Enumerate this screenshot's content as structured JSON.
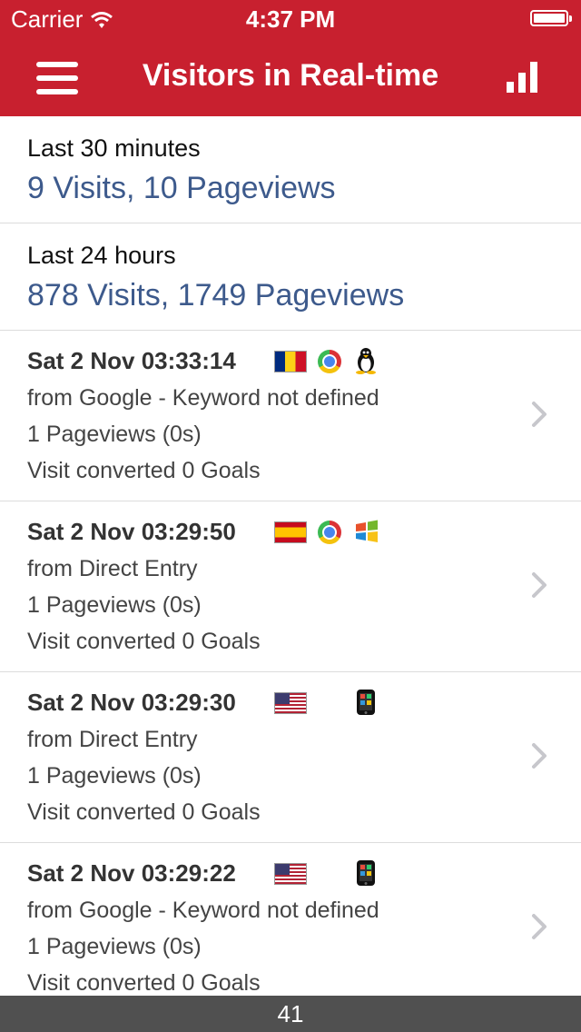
{
  "status_bar": {
    "carrier": "Carrier",
    "time": "4:37 PM"
  },
  "nav": {
    "title": "Visitors in Real-time"
  },
  "summary": [
    {
      "label": "Last 30 minutes",
      "value": "9 Visits, 10 Pageviews"
    },
    {
      "label": "Last 24 hours",
      "value": "878 Visits, 1749 Pageviews"
    }
  ],
  "visits": [
    {
      "time": "Sat 2 Nov 03:33:14",
      "source": "from Google - Keyword not defined",
      "pageviews": "1 Pageviews (0s)",
      "goals": "Visit converted 0 Goals",
      "flag_icon": "romania-flag-icon",
      "browser_icon": "chrome-icon",
      "os_icon": "linux-icon"
    },
    {
      "time": "Sat 2 Nov 03:29:50",
      "source": "from Direct Entry",
      "pageviews": "1 Pageviews (0s)",
      "goals": "Visit converted 0 Goals",
      "flag_icon": "spain-flag-icon",
      "browser_icon": "chrome-icon",
      "os_icon": "windows-icon"
    },
    {
      "time": "Sat 2 Nov 03:29:30",
      "source": "from Direct Entry",
      "pageviews": "1 Pageviews (0s)",
      "goals": "Visit converted 0 Goals",
      "flag_icon": "usa-flag-icon",
      "browser_icon": "",
      "os_icon": "ios-device-icon"
    },
    {
      "time": "Sat 2 Nov 03:29:22",
      "source": "from Google - Keyword not defined",
      "pageviews": "1 Pageviews (0s)",
      "goals": "Visit converted 0 Goals",
      "flag_icon": "usa-flag-icon",
      "browser_icon": "",
      "os_icon": "ios-device-icon"
    }
  ],
  "footer": {
    "count": "41"
  },
  "colors": {
    "header": "#c8202f",
    "accent_text": "#3d5a8c",
    "footer": "#505050"
  }
}
